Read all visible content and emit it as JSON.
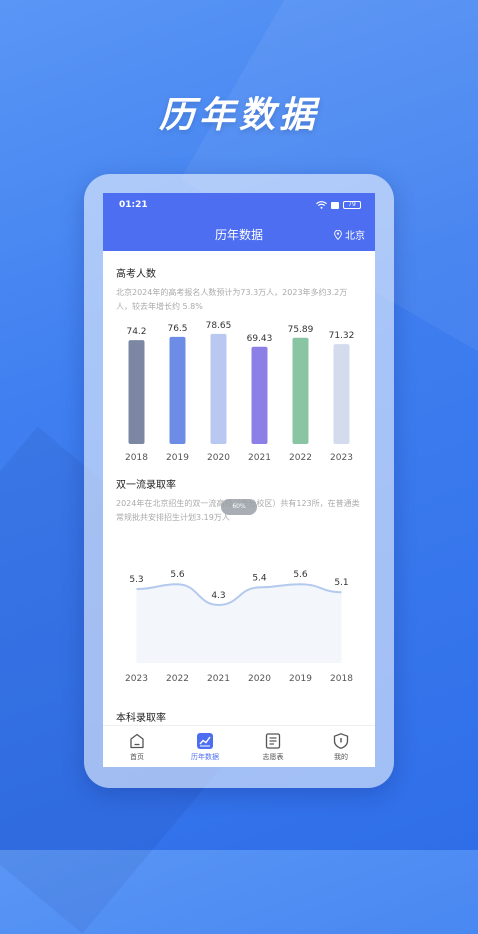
{
  "hero": {
    "title": "历年数据"
  },
  "status": {
    "time": "01:21",
    "battery": "79"
  },
  "nav": {
    "title": "历年数据",
    "location": "北京"
  },
  "section1": {
    "title": "高考人数",
    "desc": "北京2024年的高考报名人数预计为73.3万人，2023年多约3.2万人，较去年增长约 5.8%"
  },
  "section2": {
    "title": "双一流录取率",
    "desc": "2024年在北京招生的双一流高校（含分校区）共有123所，在普通类常规批共安排招生计划3.19万人"
  },
  "section3": {
    "title": "本科录取率"
  },
  "scroll_indicator": "60%",
  "tabs": [
    {
      "label": "首页",
      "icon": "home-icon"
    },
    {
      "label": "历年数据",
      "icon": "chart-icon"
    },
    {
      "label": "志愿表",
      "icon": "list-icon"
    },
    {
      "label": "我的",
      "icon": "shield-icon"
    }
  ],
  "colors": {
    "primary": "#4e6ef2"
  },
  "chart_data": [
    {
      "type": "bar",
      "categories": [
        "2018",
        "2019",
        "2020",
        "2021",
        "2022",
        "2023"
      ],
      "values": [
        74.2,
        76.5,
        78.65,
        69.43,
        75.89,
        71.32
      ],
      "value_labels": [
        "74.2",
        "76.5",
        "78.65",
        "69.43",
        "75.89",
        "71.32"
      ],
      "colors": [
        "#7c87a3",
        "#6d8ce6",
        "#b9c8f0",
        "#8c7fe6",
        "#89c4a3",
        "#d3dbec"
      ],
      "title": "高考人数"
    },
    {
      "type": "area",
      "categories": [
        "2023",
        "2022",
        "2021",
        "2020",
        "2019",
        "2018"
      ],
      "values": [
        5.3,
        5.6,
        4.3,
        5.4,
        5.6,
        5.1
      ],
      "title": "双一流录取率"
    }
  ]
}
